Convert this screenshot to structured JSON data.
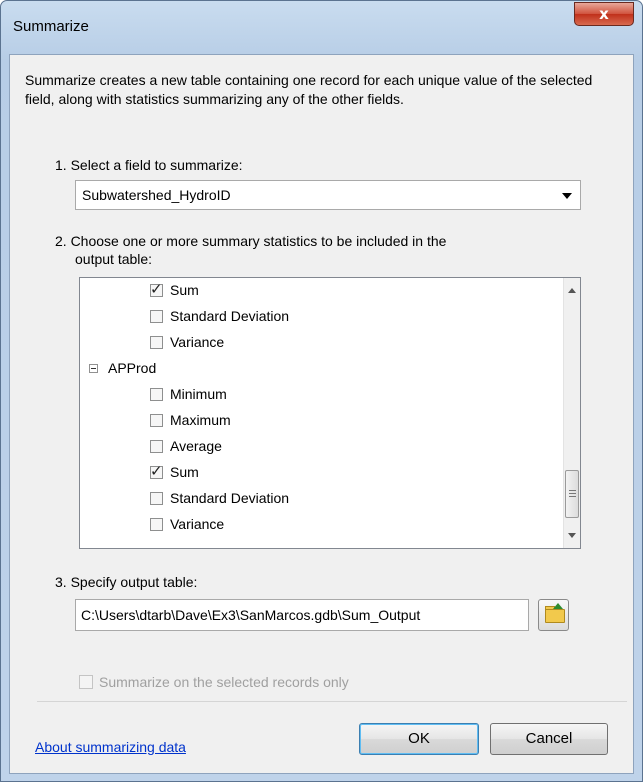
{
  "window": {
    "title": "Summarize",
    "close_glyph": "x"
  },
  "description": "Summarize creates a new table containing one record for each unique value of the selected field, along with statistics summarizing any of the other fields.",
  "step1": {
    "label": "1.  Select a field to summarize:",
    "value": "Subwatershed_HydroID"
  },
  "step2": {
    "label_line1": "2.  Choose one or more summary statistics to be included in the",
    "label_line2": "output table:",
    "items": [
      {
        "label": "Sum",
        "checked": true
      },
      {
        "label": "Standard Deviation",
        "checked": false
      },
      {
        "label": "Variance",
        "checked": false
      },
      {
        "label": "APProd",
        "group": true
      },
      {
        "label": "Minimum",
        "checked": false
      },
      {
        "label": "Maximum",
        "checked": false
      },
      {
        "label": "Average",
        "checked": false
      },
      {
        "label": "Sum",
        "checked": true
      },
      {
        "label": "Standard Deviation",
        "checked": false
      },
      {
        "label": "Variance",
        "checked": false
      }
    ]
  },
  "step3": {
    "label": "3.  Specify output table:",
    "value": "C:\\Users\\dtarb\\Dave\\Ex3\\SanMarcos.gdb\\Sum_Output"
  },
  "selected_only": {
    "label": "Summarize on the selected records only",
    "checked": false,
    "enabled": false
  },
  "footer": {
    "help_link": "About summarizing data",
    "ok_label": "OK",
    "cancel_label": "Cancel"
  }
}
